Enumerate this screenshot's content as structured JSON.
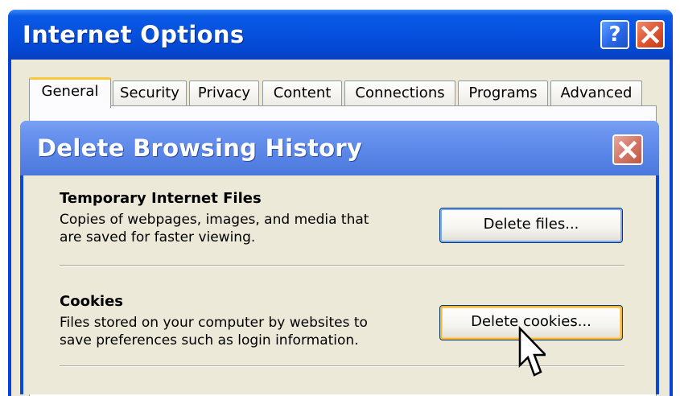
{
  "outer_window": {
    "title": "Internet Options",
    "help_button": "?",
    "tabs": [
      "General",
      "Security",
      "Privacy",
      "Content",
      "Connections",
      "Programs",
      "Advanced"
    ],
    "active_tab": "General",
    "titlebar_color": "#0650de"
  },
  "dialog": {
    "title": "Delete Browsing History",
    "titlebar_color": "#5a86e8",
    "sections": [
      {
        "heading": "Temporary Internet Files",
        "desc_line1": "Copies of webpages, images, and media that",
        "desc_line2": "are saved for faster viewing.",
        "button": "Delete files..."
      },
      {
        "heading": "Cookies",
        "desc_line1": "Files stored on your computer by websites to",
        "desc_line2": "save preferences such as login information.",
        "button": "Delete cookies..."
      }
    ]
  },
  "icons": {
    "help": "question-mark-icon",
    "close": "close-x-icon",
    "cursor": "mouse-pointer-icon"
  }
}
